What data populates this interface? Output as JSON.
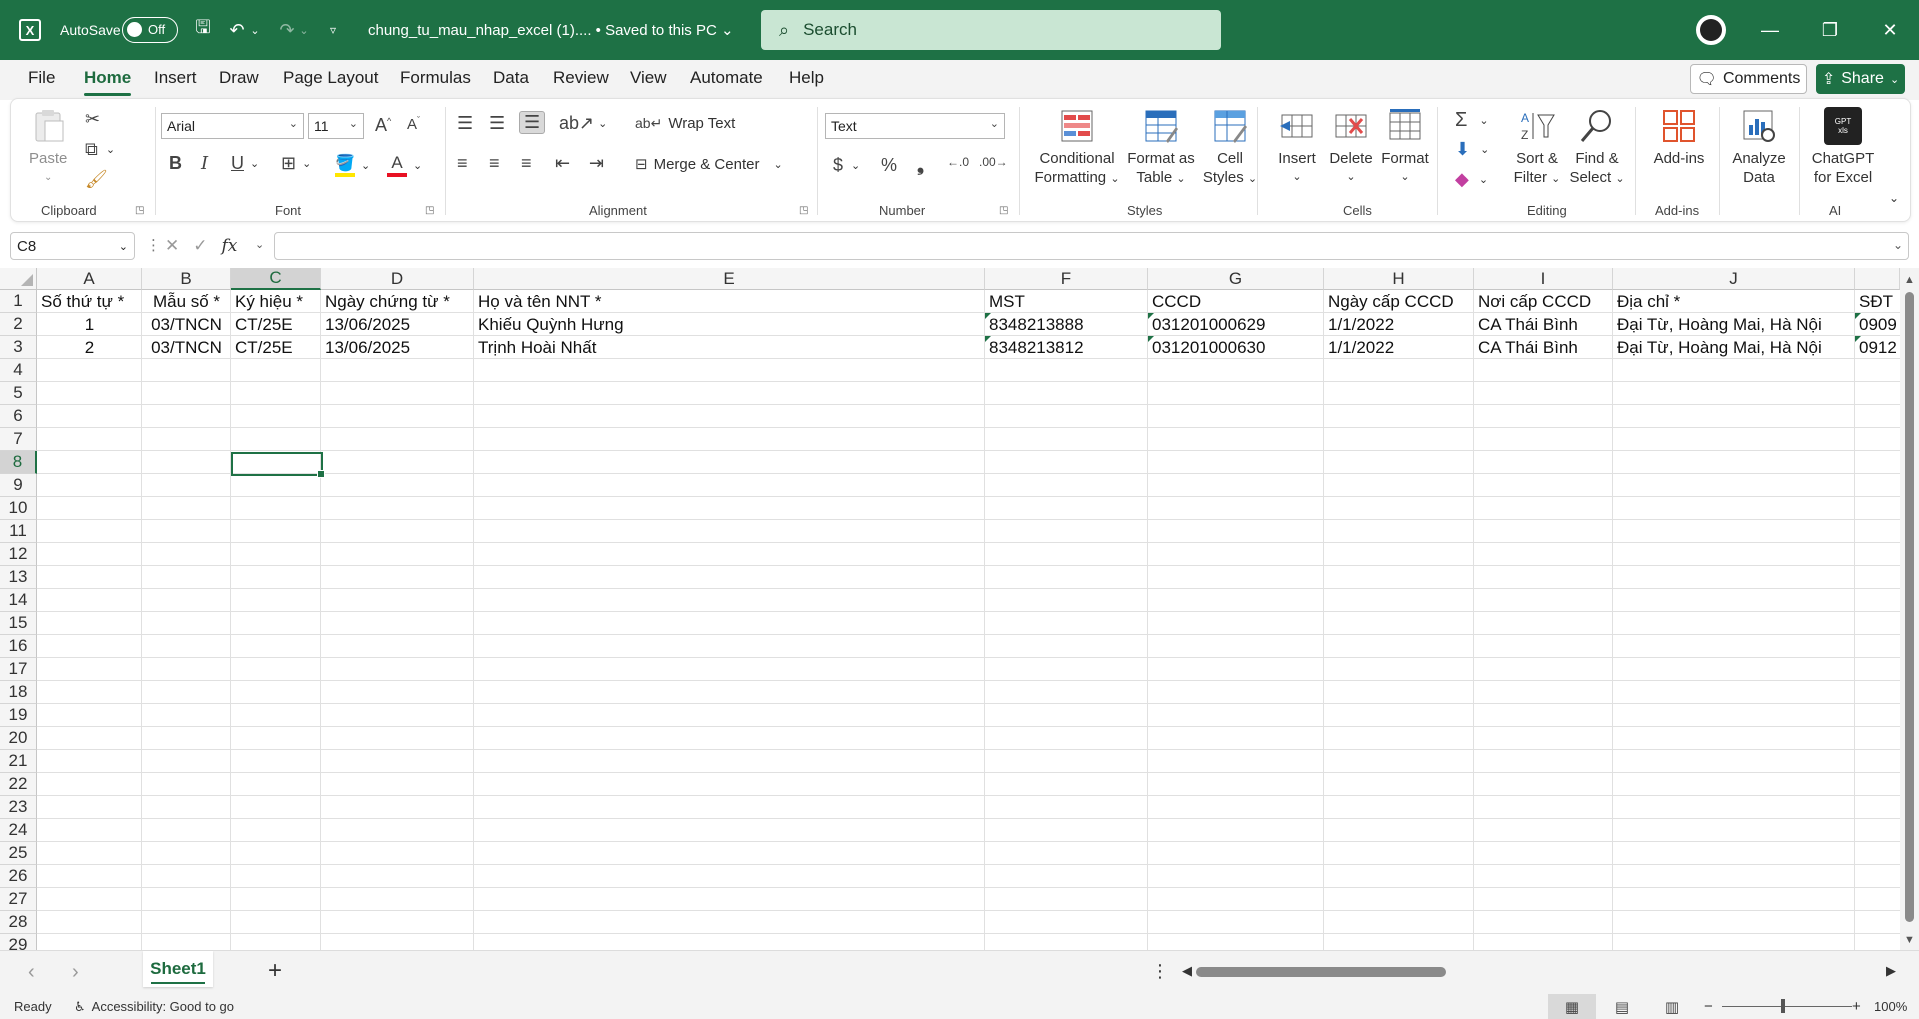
{
  "titlebar": {
    "app_icon": "excel-logo-icon",
    "autosave_label": "AutoSave",
    "autosave_state": "Off",
    "doc_title": "chung_tu_mau_nhap_excel (1).... • Saved to this PC ⌄",
    "search_placeholder": "Search"
  },
  "ribbon_tabs": [
    "File",
    "Home",
    "Insert",
    "Draw",
    "Page Layout",
    "Formulas",
    "Data",
    "Review",
    "View",
    "Automate",
    "Help"
  ],
  "active_tab": "Home",
  "header_buttons": {
    "comments": "Comments",
    "share": "Share"
  },
  "ribbon": {
    "clipboard": {
      "label": "Clipboard",
      "paste": "Paste"
    },
    "font": {
      "label": "Font",
      "name": "Arial",
      "size": "11"
    },
    "alignment": {
      "label": "Alignment",
      "wrap_text": "Wrap Text",
      "merge_center": "Merge & Center"
    },
    "number": {
      "label": "Number",
      "format": "Text"
    },
    "styles": {
      "label": "Styles",
      "conditional_1": "Conditional",
      "conditional_2": "Formatting",
      "format_table_1": "Format as",
      "format_table_2": "Table",
      "cell_styles_1": "Cell",
      "cell_styles_2": "Styles"
    },
    "cells": {
      "label": "Cells",
      "insert": "Insert",
      "delete": "Delete",
      "format": "Format"
    },
    "editing": {
      "label": "Editing",
      "sort_1": "Sort &",
      "sort_2": "Filter",
      "find_1": "Find &",
      "find_2": "Select"
    },
    "addins": {
      "label": "Add-ins",
      "addins": "Add-ins"
    },
    "analyze": {
      "label_1": "Analyze",
      "label_2": "Data"
    },
    "ai": {
      "label": "AI",
      "chatgpt_1": "ChatGPT",
      "chatgpt_2": "for Excel",
      "logo_text": "GPT for Excel"
    }
  },
  "formula_bar": {
    "name_box": "C8",
    "fx": "fx",
    "formula": ""
  },
  "grid": {
    "columns": [
      "A",
      "B",
      "C",
      "D",
      "E",
      "F",
      "G",
      "H",
      "I",
      "J"
    ],
    "selected_column": "C",
    "selected_row": "8",
    "selected_cell": "C8",
    "rows": [
      [
        "Số thứ tự *",
        "Mẫu số *",
        "Ký hiệu *",
        "Ngày chứng từ *",
        "Họ và tên NNT *",
        "MST",
        "CCCD",
        "Ngày cấp CCCD",
        "Nơi cấp CCCD",
        "Địa chỉ *",
        "SĐT"
      ],
      [
        "1",
        "03/TNCN",
        "CT/25E",
        "13/06/2025",
        "Khiếu Quỳnh Hưng",
        "8348213888",
        "031201000629",
        "1/1/2022",
        "CA Thái Bình",
        "Đại Từ, Hoàng Mai, Hà Nội",
        "0909"
      ],
      [
        "2",
        "03/TNCN",
        "CT/25E",
        "13/06/2025",
        "Trịnh Hoài Nhất",
        "8348213812",
        "031201000630",
        "1/1/2022",
        "CA Thái Bình",
        "Đại Từ, Hoàng Mai, Hà Nội",
        "0912"
      ]
    ],
    "row_numbers": [
      "1",
      "2",
      "3",
      "4",
      "5",
      "6",
      "7",
      "8",
      "9",
      "10",
      "11",
      "12",
      "13",
      "14",
      "15",
      "16",
      "17",
      "18",
      "19",
      "20",
      "21",
      "22",
      "23",
      "24",
      "25",
      "26",
      "27",
      "28",
      "29"
    ]
  },
  "sheets": {
    "active": "Sheet1"
  },
  "status": {
    "ready": "Ready",
    "accessibility": "Accessibility: Good to go",
    "zoom": "100%"
  },
  "colors": {
    "excel_green": "#1e7145",
    "search_bg": "#c9e6d3",
    "selection": "#1e7145"
  }
}
